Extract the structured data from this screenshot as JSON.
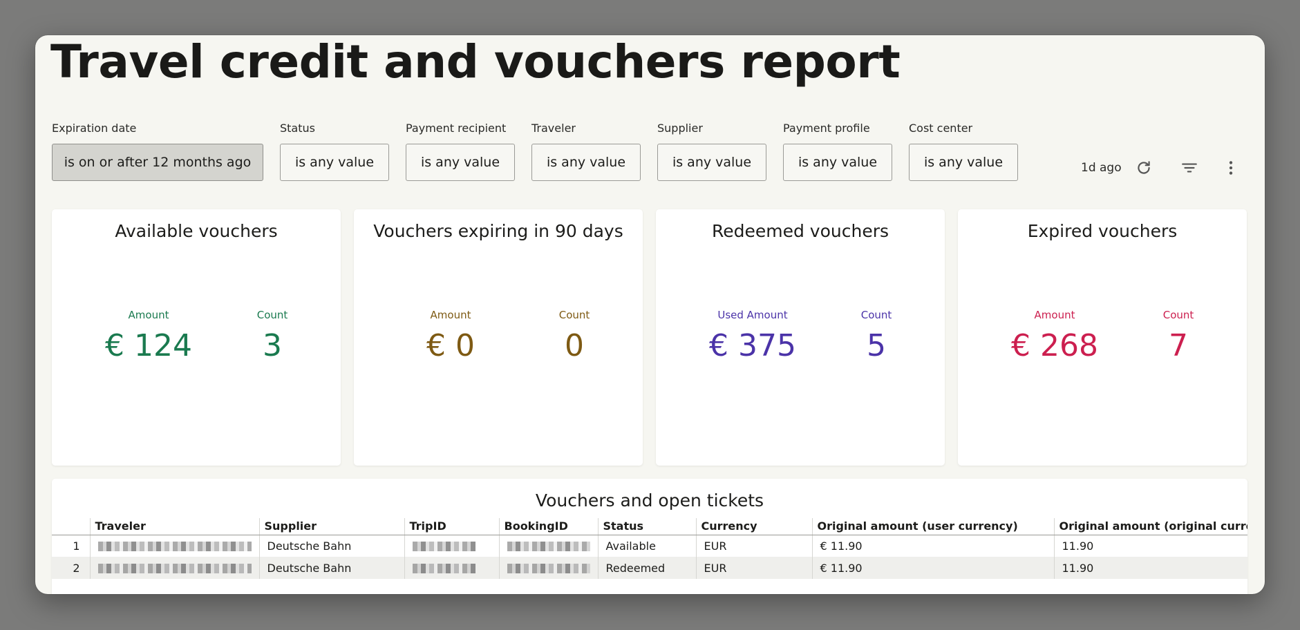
{
  "page": {
    "title": "Travel credit and vouchers report"
  },
  "filters": [
    {
      "label": "Expiration date",
      "value": "is on or after 12 months ago"
    },
    {
      "label": "Status",
      "value": "is any value"
    },
    {
      "label": "Payment recipient",
      "value": "is any value"
    },
    {
      "label": "Traveler",
      "value": "is any value"
    },
    {
      "label": "Supplier",
      "value": "is any value"
    },
    {
      "label": "Payment profile",
      "value": "is any value"
    },
    {
      "label": "Cost center",
      "value": "is any value"
    }
  ],
  "toolbar": {
    "refresh_time": "1d ago",
    "icons": [
      "refresh-icon",
      "filter-icon",
      "more-vertical-icon"
    ]
  },
  "cards": [
    {
      "title": "Available vouchers",
      "color": "#1a7a4f",
      "metrics": [
        {
          "label": "Amount",
          "value": "€ 124"
        },
        {
          "label": "Count",
          "value": "3"
        }
      ]
    },
    {
      "title": "Vouchers expiring in 90 days",
      "color": "#7e5a13",
      "metrics": [
        {
          "label": "Amount",
          "value": "€ 0"
        },
        {
          "label": "Count",
          "value": "0"
        }
      ]
    },
    {
      "title": "Redeemed vouchers",
      "color": "#4b33a8",
      "metrics": [
        {
          "label": "Used Amount",
          "value": "€ 375"
        },
        {
          "label": "Count",
          "value": "5"
        }
      ]
    },
    {
      "title": "Expired vouchers",
      "color": "#cc1f4f",
      "metrics": [
        {
          "label": "Amount",
          "value": "€ 268"
        },
        {
          "label": "Count",
          "value": "7"
        }
      ]
    }
  ],
  "table": {
    "title": "Vouchers and open tickets",
    "columns": [
      "Traveler",
      "Supplier",
      "TripID",
      "BookingID",
      "Status",
      "Currency",
      "Original amount (user currency)",
      "Original amount (original currency)"
    ],
    "rows": [
      {
        "num": "1",
        "supplier": "Deutsche Bahn",
        "status": "Available",
        "currency": "EUR",
        "amount_user": "€ 11.90",
        "amount_orig": "11.90"
      },
      {
        "num": "2",
        "supplier": "Deutsche Bahn",
        "status": "Redeemed",
        "currency": "EUR",
        "amount_user": "€ 11.90",
        "amount_orig": "11.90"
      }
    ]
  }
}
